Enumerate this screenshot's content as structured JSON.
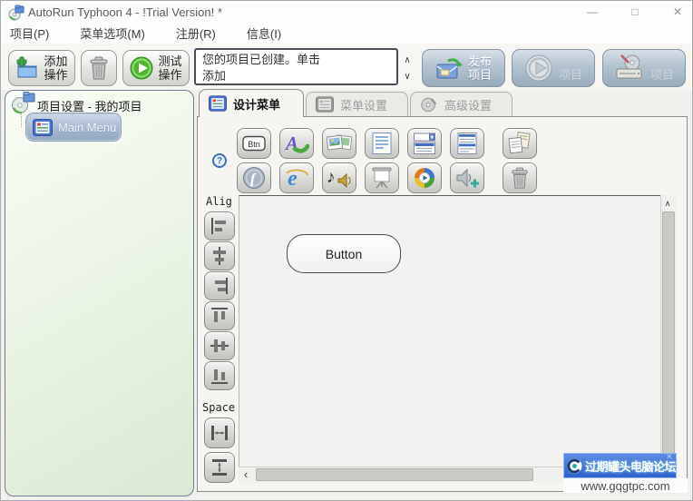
{
  "window": {
    "title": "AutoRun Typhoon 4 - !Trial Version! *",
    "controls": {
      "minimize": "—",
      "maximize": "□",
      "close": "✕"
    }
  },
  "menubar": {
    "items": [
      {
        "label": "项目(P)"
      },
      {
        "label": "菜单选项(M)"
      },
      {
        "label": "注册(R)"
      },
      {
        "label": "信息(I)"
      }
    ]
  },
  "toolbar": {
    "add_button": {
      "line1": "添加",
      "line2": "操作"
    },
    "test_button": {
      "line1": "测试",
      "line2": "操作"
    },
    "status_message": {
      "line1": "您的项目已创建。单击",
      "line2": "添加"
    },
    "publish_button": {
      "line1": "发布",
      "line2": "项目"
    },
    "preview_button_label": "项目",
    "burn_button_label": "项目"
  },
  "sidebar": {
    "header": "项目设置 - 我的项目",
    "tree": [
      {
        "label": "Main Menu",
        "selected": true
      }
    ]
  },
  "tabs": [
    {
      "label": "设计菜单",
      "active": true
    },
    {
      "label": "菜单设置",
      "active": false
    },
    {
      "label": "高级设置",
      "active": false
    }
  ],
  "toolbox": {
    "button_tool_glyph": "Btn",
    "row1": [
      "button-tool",
      "label-tool",
      "image-tool",
      "text-tool",
      "combobox-tool",
      "listbox-tool",
      "paste-tool"
    ],
    "row2": [
      "flash-tool",
      "browser-tool",
      "audio-tool",
      "slideshow-tool",
      "media-player-tool",
      "sound-tool",
      "delete-tool"
    ]
  },
  "align_panel": {
    "align_label": "Alig",
    "space_label": "Space"
  },
  "canvas": {
    "button_widget_label": "Button"
  },
  "watermark": {
    "site_name": "过期罐头电脑论坛",
    "site_url": "www.gqgtpc.com",
    "close_glyph": "✕"
  },
  "icons": {
    "help": "?",
    "spin_up": "∧",
    "spin_down": "∨",
    "scroll_up": "∧",
    "scroll_left": "‹"
  },
  "colors": {
    "publish_button_bg": "#a9bccb",
    "toolbar_button_bg": "#e3e3df",
    "selected_tree_item_bg": "#9fb3cd",
    "watermark_bg": "#3b6fd6",
    "play_green": "#3db523",
    "sidebar_bg": "#e9f3e3",
    "canvas_bg": "#f3f2f0"
  }
}
